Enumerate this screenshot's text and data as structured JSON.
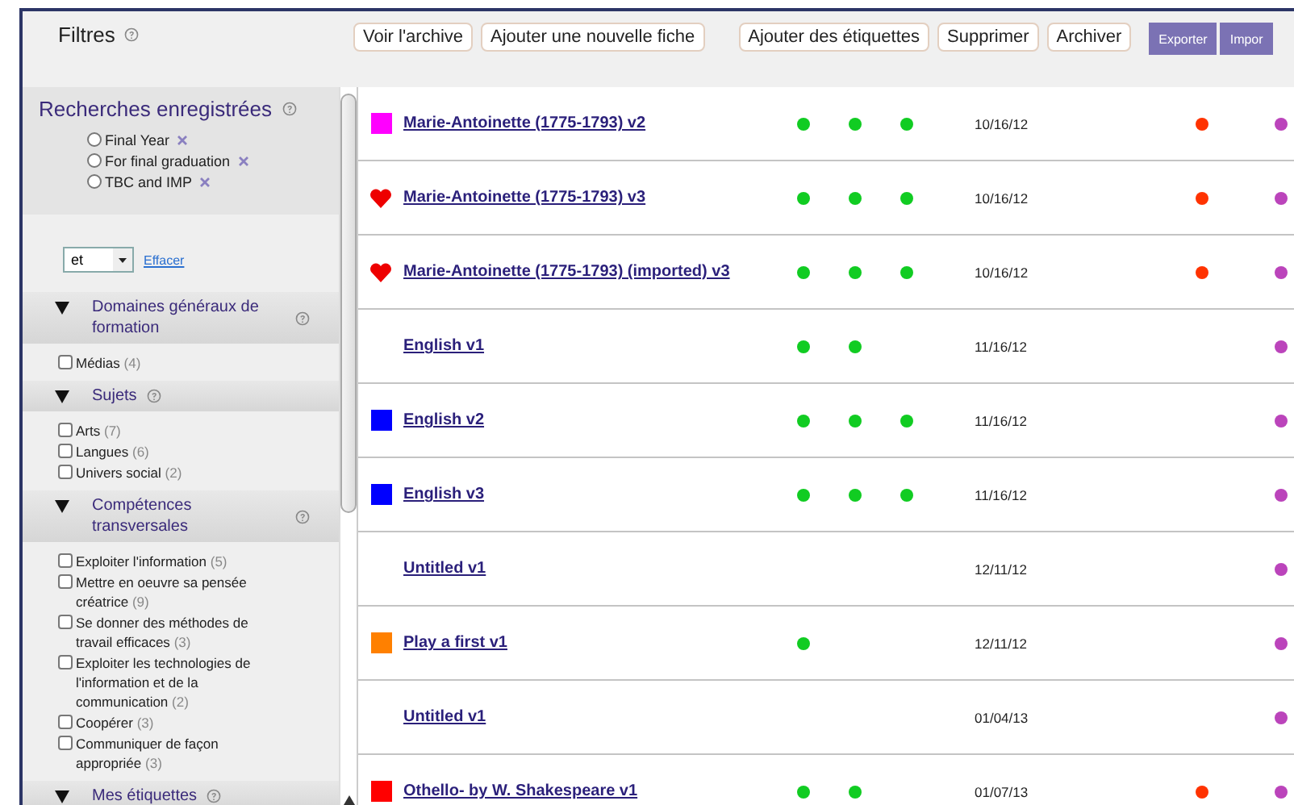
{
  "header": {
    "title": "Filtres",
    "buttons": [
      {
        "label": "Voir l'archive",
        "kind": "plain"
      },
      {
        "label": "Ajouter une nouvelle fiche",
        "kind": "plain"
      },
      {
        "label": "Ajouter des étiquettes",
        "kind": "plain"
      },
      {
        "label": "Supprimer",
        "kind": "plain"
      },
      {
        "label": "Archiver",
        "kind": "plain"
      },
      {
        "label": "Exporter",
        "kind": "accent"
      },
      {
        "label": "Impor",
        "kind": "accent"
      }
    ]
  },
  "saved_searches": {
    "title": "Recherches enregistrées",
    "items": [
      {
        "label": "Final Year",
        "selected": false
      },
      {
        "label": "For final graduation",
        "selected": false
      },
      {
        "label": "TBC and IMP",
        "selected": false
      }
    ]
  },
  "operator": {
    "value": "et",
    "clear_link": "Effacer"
  },
  "filter_groups": [
    {
      "title": "Domaines généraux de formation",
      "expanded": true,
      "items": [
        {
          "label": "Médias",
          "count": "(4)",
          "checked": false
        }
      ]
    },
    {
      "title": "Sujets",
      "expanded": true,
      "items": [
        {
          "label": "Arts",
          "count": "(7)",
          "checked": false
        },
        {
          "label": "Langues",
          "count": "(6)",
          "checked": false
        },
        {
          "label": "Univers social",
          "count": "(2)",
          "checked": false
        }
      ]
    },
    {
      "title": "Compétences transversales",
      "expanded": true,
      "items": [
        {
          "label": "Exploiter l'information",
          "count": "(5)",
          "checked": false
        },
        {
          "label": "Mettre en oeuvre sa pensée créatrice",
          "count": "(9)",
          "checked": false
        },
        {
          "label": "Se donner des méthodes de travail efficaces",
          "count": "(3)",
          "checked": false
        },
        {
          "label": "Exploiter les technologies de l'information et de la communication",
          "count": "(2)",
          "checked": false
        },
        {
          "label": "Coopérer",
          "count": "(3)",
          "checked": false
        },
        {
          "label": "Communiquer de façon appropriée",
          "count": "(3)",
          "checked": false
        }
      ]
    },
    {
      "title": "Mes étiquettes",
      "expanded": true
    }
  ],
  "rows": [
    {
      "marker": {
        "kind": "square",
        "color": "#ff00ff"
      },
      "title": "Marie-Antoinette (1775-1793) v2",
      "status_1": true,
      "status_2": true,
      "status_3": true,
      "date": "10/16/12",
      "alert": true,
      "tagged": true
    },
    {
      "marker": {
        "kind": "heart",
        "color": "#ee0000"
      },
      "title": "Marie-Antoinette (1775-1793) v3",
      "status_1": true,
      "status_2": true,
      "status_3": true,
      "date": "10/16/12",
      "alert": true,
      "tagged": true
    },
    {
      "marker": {
        "kind": "heart",
        "color": "#ee0000"
      },
      "title": "Marie-Antoinette (1775-1793) (imported) v3",
      "status_1": true,
      "status_2": true,
      "status_3": true,
      "date": "10/16/12",
      "alert": true,
      "tagged": true
    },
    {
      "title": "English v1",
      "status_1": true,
      "status_2": true,
      "status_3": false,
      "date": "11/16/12",
      "alert": false,
      "tagged": true
    },
    {
      "marker": {
        "kind": "square",
        "color": "#0000ff"
      },
      "title": "English v2",
      "status_1": true,
      "status_2": true,
      "status_3": true,
      "date": "11/16/12",
      "alert": false,
      "tagged": true
    },
    {
      "marker": {
        "kind": "square",
        "color": "#0000ff"
      },
      "title": "English v3",
      "status_1": true,
      "status_2": true,
      "status_3": true,
      "date": "11/16/12",
      "alert": false,
      "tagged": true
    },
    {
      "title": "Untitled v1",
      "status_1": false,
      "status_2": false,
      "status_3": false,
      "date": "12/11/12",
      "alert": false,
      "tagged": true
    },
    {
      "marker": {
        "kind": "square",
        "color": "#ff8000"
      },
      "title": "Play a first v1",
      "status_1": true,
      "status_2": false,
      "status_3": false,
      "date": "12/11/12",
      "alert": false,
      "tagged": true
    },
    {
      "title": "Untitled v1",
      "status_1": false,
      "status_2": false,
      "status_3": false,
      "date": "01/04/13",
      "alert": false,
      "tagged": true
    },
    {
      "marker": {
        "kind": "square",
        "color": "#ff0000"
      },
      "title": "Othello- by W. Shakespeare v1",
      "status_1": true,
      "status_2": true,
      "status_3": false,
      "date": "01/07/13",
      "alert": true,
      "tagged": true
    }
  ]
}
